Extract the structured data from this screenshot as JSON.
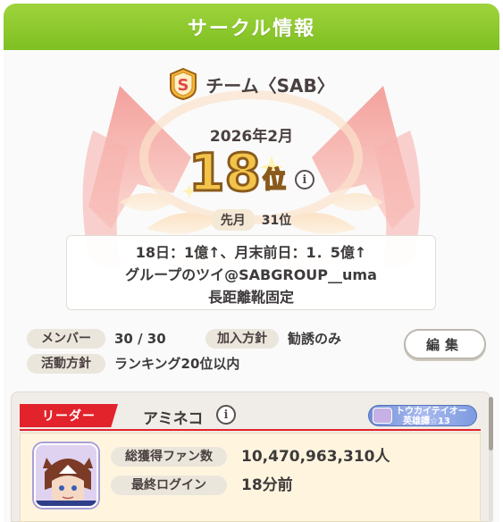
{
  "header": {
    "title": "サークル情報"
  },
  "team": {
    "name": "チーム〈SAB〉",
    "badge_letter": "S"
  },
  "ranking": {
    "month": "2026年2月",
    "rank": "18",
    "rank_unit": "位",
    "info_icon": "i",
    "last_month_label": "先月",
    "last_month_value": "31位"
  },
  "description": {
    "lines": [
      "18日：1億↑、月末前日：1．5億↑",
      "グループのツイ@SABGROUP__uma",
      "長距離靴固定"
    ]
  },
  "fields": {
    "members_label": "メンバー",
    "members_value": "30 / 30",
    "join_label": "加入方針",
    "join_value": "勧誘のみ",
    "activity_label": "活動方針",
    "activity_value": "ランキング20位以内"
  },
  "edit_button": {
    "label": "編集"
  },
  "leader": {
    "tag": "リーダー",
    "name": "アミネコ",
    "info_icon": "i",
    "title_line1": "トウカイテイオー",
    "title_line2": "英雄譚☆13",
    "fans_label": "総獲得ファン数",
    "fans_value": "10,470,963,310人",
    "login_label": "最終ログイン",
    "login_value": "18分前"
  },
  "icons": {
    "badge": "rank-s-emblem-icon",
    "info": "info-icon",
    "avatar": "tokai-teio-avatar"
  },
  "colors": {
    "header_green": "#8cc92f",
    "leader_red": "#e2232b",
    "rank_gold": "#f3c44a",
    "emblem_pink": "#f4a7a4"
  }
}
